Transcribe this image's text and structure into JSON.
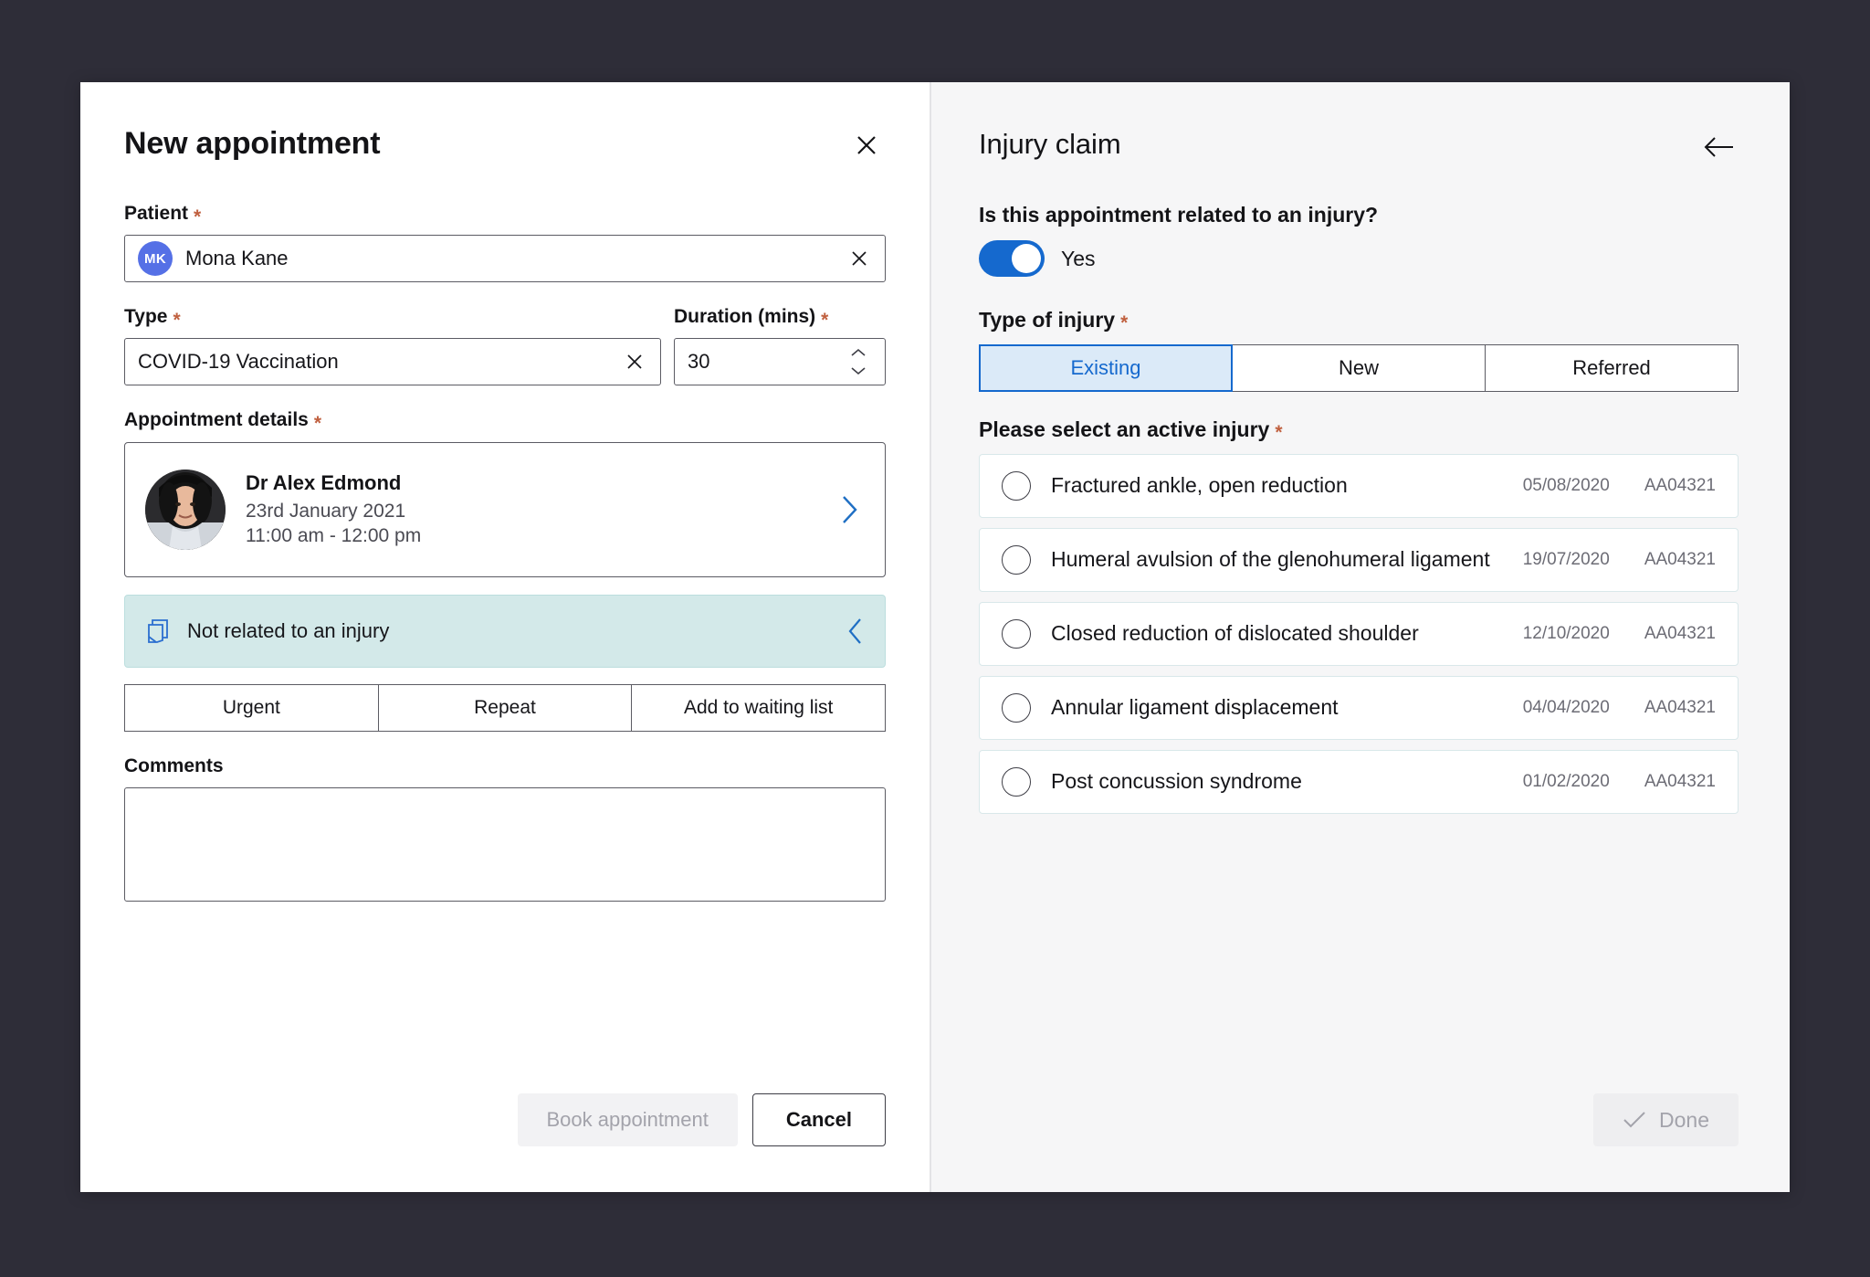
{
  "left_panel": {
    "title": "New appointment",
    "close_icon": "close-icon",
    "patient": {
      "label": "Patient",
      "required_mark": "*",
      "avatar_initials": "MK",
      "value": "Mona Kane",
      "clear_icon": "close-icon"
    },
    "type": {
      "label": "Type",
      "required_mark": "*",
      "value": "COVID-19 Vaccination",
      "clear_icon": "close-icon"
    },
    "duration": {
      "label": "Duration (mins)",
      "required_mark": "*",
      "value": "30",
      "up_icon": "chevron-up-icon",
      "down_icon": "chevron-down-icon"
    },
    "appointment_details": {
      "label": "Appointment details",
      "required_mark": "*",
      "doctor_name": "Dr Alex Edmond",
      "date": "23rd January 2021",
      "time": "11:00 am - 12:00 pm",
      "chevron_icon": "chevron-right-icon"
    },
    "injury_banner": {
      "icon": "document-page-icon",
      "text": "Not related to an injury",
      "collapse_icon": "chevron-left-icon",
      "background_color": "#d3e9e9"
    },
    "toggle_buttons": [
      "Urgent",
      "Repeat",
      "Add to waiting list"
    ],
    "comments": {
      "label": "Comments",
      "value": "",
      "placeholder": ""
    },
    "footer": {
      "book_label": "Book appointment",
      "cancel_label": "Cancel"
    }
  },
  "right_panel": {
    "title": "Injury claim",
    "back_icon": "arrow-left-icon",
    "question": "Is this appointment related to an injury?",
    "toggle": {
      "state_label": "Yes",
      "on": true,
      "color": "#1569ce"
    },
    "type_of_injury": {
      "label": "Type of injury",
      "required_mark": "*",
      "options": [
        "Existing",
        "New",
        "Referred"
      ],
      "selected": "Existing",
      "active_color": "#1569ce"
    },
    "select_injury": {
      "label": "Please select an active injury",
      "required_mark": "*",
      "items": [
        {
          "name": "Fractured ankle, open reduction",
          "date": "05/08/2020",
          "code": "AA04321",
          "selected": false
        },
        {
          "name": "Humeral avulsion of the glenohumeral ligament",
          "date": "19/07/2020",
          "code": "AA04321",
          "selected": false
        },
        {
          "name": "Closed reduction of dislocated shoulder",
          "date": "12/10/2020",
          "code": "AA04321",
          "selected": false
        },
        {
          "name": "Annular ligament displacement",
          "date": "04/04/2020",
          "code": "AA04321",
          "selected": false
        },
        {
          "name": "Post concussion syndrome",
          "date": "01/02/2020",
          "code": "AA04321",
          "selected": false
        }
      ]
    },
    "footer": {
      "done_label": "Done",
      "done_icon": "check-icon"
    }
  }
}
